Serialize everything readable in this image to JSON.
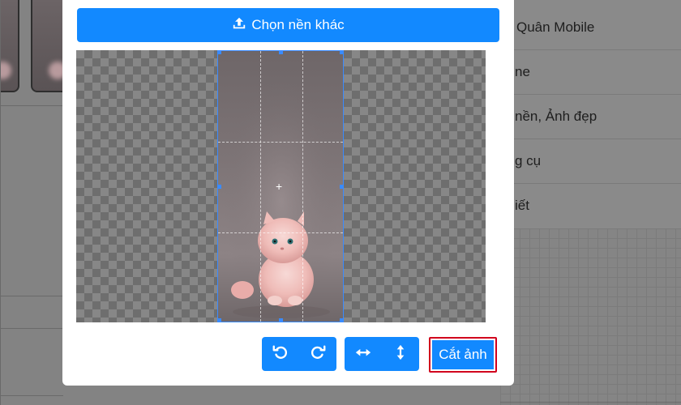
{
  "background_menu": {
    "items": [
      {
        "label": "Quân Mobile"
      },
      {
        "label": "ne"
      },
      {
        "label": "nền, Ảnh đẹp"
      },
      {
        "label": "g cụ"
      },
      {
        "label": "iết"
      }
    ]
  },
  "modal": {
    "upload_button": {
      "label": "Chọn nền khác",
      "icon": "upload-icon"
    },
    "editor": {
      "center_marker": "+"
    },
    "toolbar": {
      "rotate_left_icon": "rotate-left-icon",
      "rotate_right_icon": "rotate-right-icon",
      "flip_horizontal_icon": "flip-horizontal-icon",
      "flip_vertical_icon": "flip-vertical-icon"
    },
    "crop_button": {
      "label": "Cắt ảnh"
    }
  },
  "colors": {
    "primary": "#1289ff",
    "crop_guide": "#3a8bff",
    "highlight_border": "#d1001d"
  }
}
